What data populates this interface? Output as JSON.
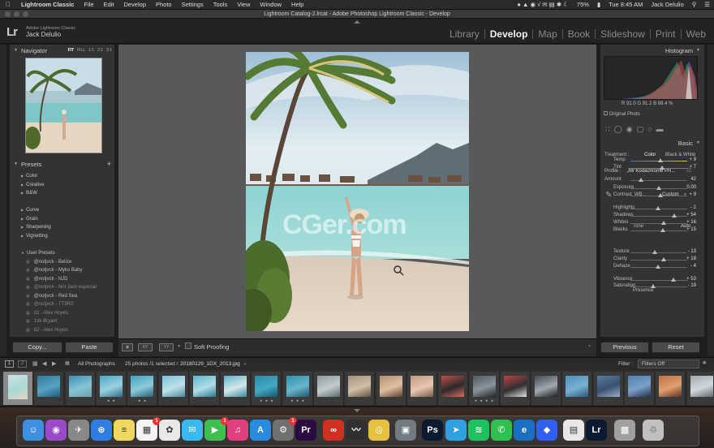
{
  "menubar": {
    "app": "Lightroom Classic",
    "items": [
      "File",
      "Edit",
      "Develop",
      "Photo",
      "Settings",
      "Tools",
      "View",
      "Window",
      "Help"
    ],
    "battery": "75%",
    "clock": "Tue 8:45 AM",
    "user": "Jack Delulio"
  },
  "window": {
    "title": "Lightroom Catalog-2.lrcat - Adobe Photoshop Lightroom Classic - Develop"
  },
  "identity": {
    "logo": "Lr",
    "product": "Adobe Lightroom Classic",
    "user": "Jack Delulio"
  },
  "modules": [
    {
      "label": "Library",
      "active": false
    },
    {
      "label": "Develop",
      "active": true
    },
    {
      "label": "Map",
      "active": false
    },
    {
      "label": "Book",
      "active": false
    },
    {
      "label": "Slideshow",
      "active": false
    },
    {
      "label": "Print",
      "active": false
    },
    {
      "label": "Web",
      "active": false
    }
  ],
  "navigator": {
    "title": "Navigator",
    "options": [
      "FIT",
      "FILL",
      "1:1",
      "2:1",
      "3:1"
    ]
  },
  "presets": {
    "title": "Presets",
    "add": "+",
    "group1": [
      "Color",
      "Creative",
      "B&W"
    ],
    "group2": [
      "Curve",
      "Grain",
      "Sharpening",
      "Vignetting"
    ],
    "user_title": "User Presets",
    "user_items": [
      "@notjvck - Belize",
      "@notjvck - Myko Baby",
      "@notjvck - NJD",
      "@notjvck - Not Jack especial",
      "@notjvck - Red Sea",
      "@notjvck - TT3RS",
      "01 - Alex Hoyes",
      "1dx Bryant",
      "02 - Alex Hoyes"
    ]
  },
  "left_buttons": {
    "copy": "Copy...",
    "paste": "Paste"
  },
  "watermark": "CGer.com",
  "toolbar": {
    "soft_proofing": "Soft Proofing"
  },
  "histogram": {
    "title": "Histogram",
    "r_label": "R",
    "r_value": "91.0",
    "g_label": "G",
    "g_value": "91.2",
    "b_label": "B",
    "b_value": "88.4",
    "unit": "%",
    "original": "Original Photo"
  },
  "basic": {
    "title": "Basic",
    "treatment_label": "Treatment :",
    "color": "Color",
    "bw": "Black & White",
    "profile_label": "Profile :",
    "profile_value": "JW Kodachrome PR...",
    "amount_label": "Amount",
    "amount_value": "42",
    "wb_label": "WB :",
    "wb_value": "Custom",
    "tone_label": "Tone",
    "auto": "Auto",
    "presence_label": "Presence",
    "rows": [
      {
        "label": "Temp",
        "value": "+ 9",
        "pos": 0.53
      },
      {
        "label": "Tint",
        "value": "+ 7",
        "pos": 0.55
      },
      {
        "label": "Exposure",
        "value": "0.00",
        "pos": 0.5
      },
      {
        "label": "Contrast",
        "value": "+ 9",
        "pos": 0.53
      },
      {
        "label": "Highlights",
        "value": "- 2",
        "pos": 0.49
      },
      {
        "label": "Shadows",
        "value": "+ 54",
        "pos": 0.77
      },
      {
        "label": "Whites",
        "value": "+ 16",
        "pos": 0.58
      },
      {
        "label": "Blacks",
        "value": "+ 15",
        "pos": 0.57
      },
      {
        "label": "Texture",
        "value": "- 13",
        "pos": 0.43
      },
      {
        "label": "Clarity",
        "value": "+ 18",
        "pos": 0.59
      },
      {
        "label": "Dehaze",
        "value": "- 4",
        "pos": 0.48
      },
      {
        "label": "Vibrance",
        "value": "+ 53",
        "pos": 0.76
      },
      {
        "label": "Saturation",
        "value": "- 19",
        "pos": 0.4
      }
    ]
  },
  "right_buttons": {
    "previous": "Previous",
    "reset": "Reset"
  },
  "filmstrip": {
    "page1": "1",
    "page2": "2",
    "source": "All Photographs",
    "count": "25 photos /1 selected /",
    "filename": "20180129_1DX_2013.jpg",
    "filter_label": "Filter :",
    "filter_value": "Filters Off"
  },
  "dock": {
    "badges": [
      "1",
      "1",
      "1"
    ]
  }
}
